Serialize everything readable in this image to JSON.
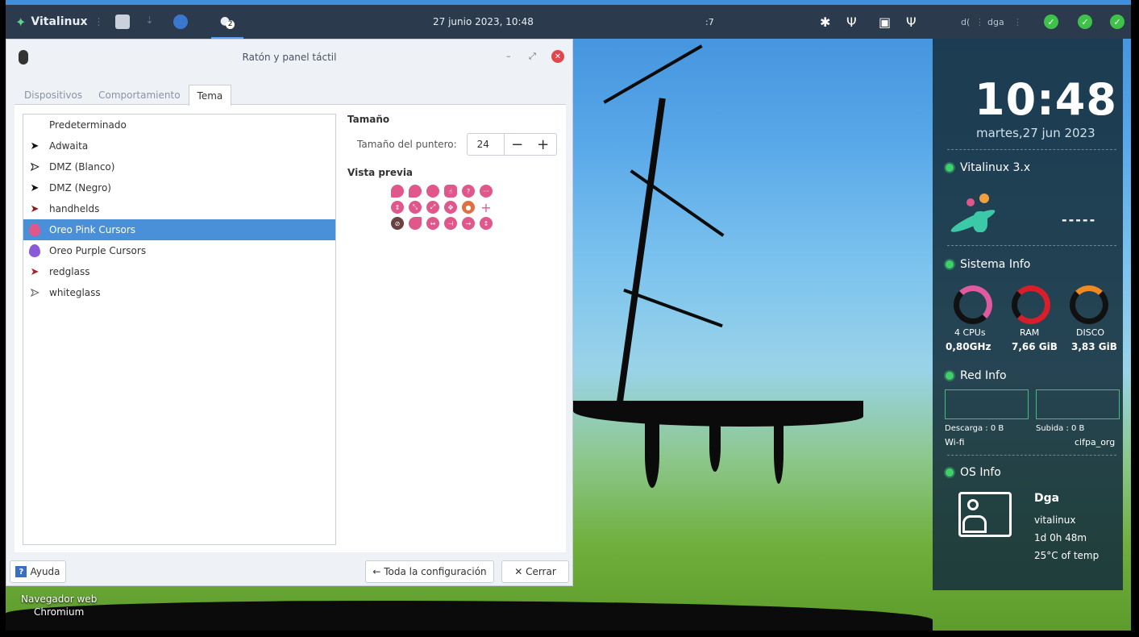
{
  "top_panel": {
    "brand": "Vitalinux",
    "clock": "27 junio 2023, 10:48",
    "workspace": ":7",
    "user_short": "d(",
    "user": "dga",
    "active_badge": "2"
  },
  "window": {
    "title": "Ratón y panel táctil",
    "tabs": [
      "Dispositivos",
      "Comportamiento",
      "Tema"
    ],
    "active_tab": "Tema",
    "themes": [
      {
        "label": "Predeterminado",
        "icon": "none"
      },
      {
        "label": "Adwaita",
        "icon": "black-arrow"
      },
      {
        "label": "DMZ (Blanco)",
        "icon": "white-arrow"
      },
      {
        "label": "DMZ (Negro)",
        "icon": "black-arrow"
      },
      {
        "label": "handhelds",
        "icon": "red-arrow"
      },
      {
        "label": "Oreo Pink Cursors",
        "icon": "pink-blob"
      },
      {
        "label": "Oreo Purple Cursors",
        "icon": "purple-blob"
      },
      {
        "label": "redglass",
        "icon": "red-arrow"
      },
      {
        "label": "whiteglass",
        "icon": "white-arrow"
      }
    ],
    "selected_theme": "Oreo Pink Cursors",
    "size_section": "Tamaño",
    "size_label": "Tamaño del puntero:",
    "size_value": "24",
    "preview_section": "Vista previa",
    "help_label": "Ayuda",
    "all_settings_label": "← Toda la configuración",
    "close_label": "✕ Cerrar",
    "accent_color": "#4a90d9",
    "cursor_color": "#e0578c"
  },
  "desktop_icon": {
    "line1": "Navegador web",
    "line2": "Chromium"
  },
  "conky": {
    "time": "10:48",
    "date": "martes,27 jun 2023",
    "distro": "Vitalinux 3.x",
    "dashes": "-----",
    "sys_title": "Sistema Info",
    "cpu_label": "4 CPUs",
    "cpu_value": "0,80GHz",
    "ram_label": "RAM",
    "ram_value": "7,66 GiB",
    "disk_label": "DISCO",
    "disk_value": "3,83 GiB",
    "net_title": "Red Info",
    "download": "Descarga : 0 B",
    "upload": "Subida : 0 B",
    "net_type": "Wi-fi",
    "ssid": "cifpa_org",
    "os_title": "OS Info",
    "user": "Dga",
    "host": "vitalinux",
    "uptime": "1d 0h 48m",
    "temp": "25°C of temp"
  }
}
